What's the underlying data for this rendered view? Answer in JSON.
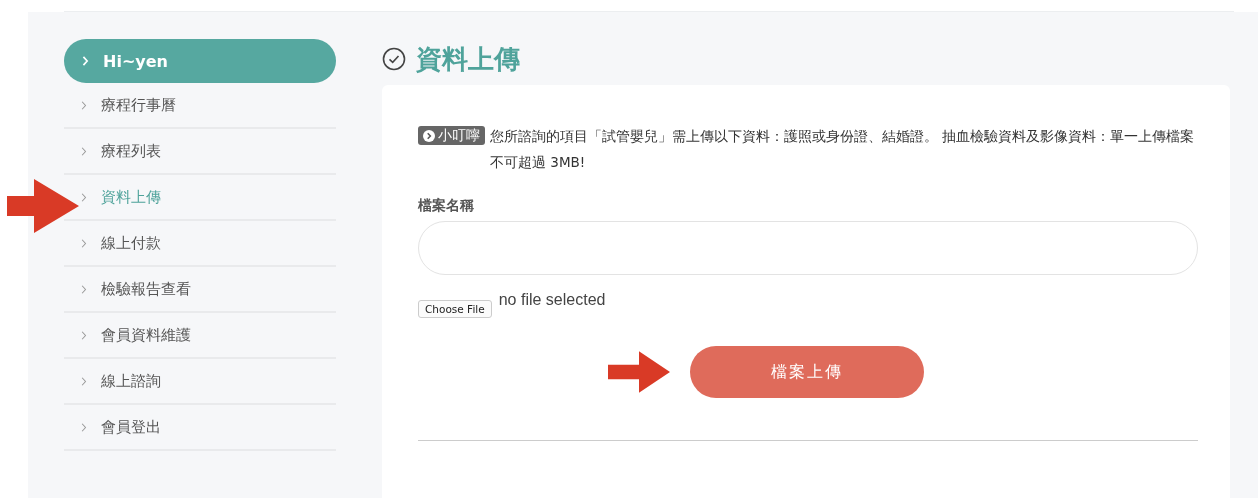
{
  "sidebar": {
    "user": "Hi~yen",
    "items": [
      {
        "label": "療程行事曆",
        "selected": false
      },
      {
        "label": "療程列表",
        "selected": false
      },
      {
        "label": "資料上傳",
        "selected": true
      },
      {
        "label": "線上付款",
        "selected": false
      },
      {
        "label": "檢驗報告查看",
        "selected": false
      },
      {
        "label": "會員資料維護",
        "selected": false
      },
      {
        "label": "線上諮詢",
        "selected": false
      },
      {
        "label": "會員登出",
        "selected": false
      }
    ]
  },
  "page_title": "資料上傳",
  "notice": {
    "badge": "小叮嚀",
    "text": "您所諮詢的項目「試管嬰兒」需上傳以下資料：護照或身份證、結婚證。 抽血檢驗資料及影像資料：單一上傳檔案不可超過 3MB!"
  },
  "form": {
    "field_label": "檔案名稱",
    "file_button": "Choose File",
    "file_status": "no file selected",
    "submit": "檔案上傳"
  }
}
